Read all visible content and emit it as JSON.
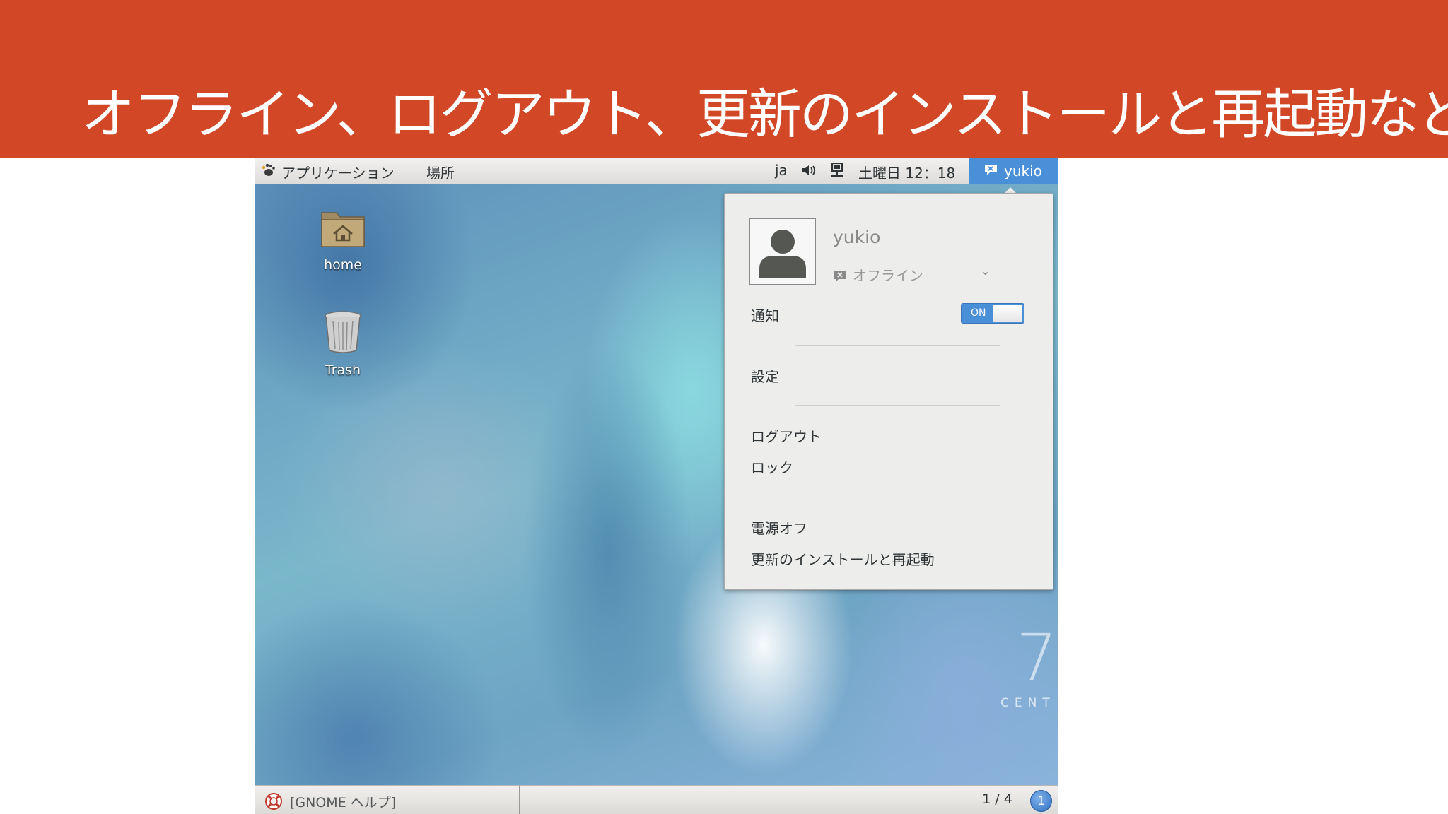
{
  "slide": {
    "title": "オフライン、ログアウト、更新のインストールと再起動など",
    "banner_color": "#d24726"
  },
  "topbar": {
    "applications_label": "アプリケーション",
    "places_label": "場所",
    "input_method": "ja",
    "datetime": "土曜日 12：18",
    "user_button": "yukio",
    "icons": [
      "gnome-foot-icon",
      "volume-icon",
      "network-icon",
      "chat-status-icon"
    ]
  },
  "desktop_icons": [
    {
      "label": "home",
      "icon": "home-folder-icon"
    },
    {
      "label": "Trash",
      "icon": "trash-icon"
    }
  ],
  "user_menu": {
    "username": "yukio",
    "status": "オフライン",
    "notifications_label": "通知",
    "notifications_toggle": "ON",
    "settings": "設定",
    "logout": "ログアウト",
    "lock": "ロック",
    "power_off": "電源オフ",
    "install_updates_restart": "更新のインストールと再起動"
  },
  "watermark": {
    "number": "7",
    "text": "CENT"
  },
  "bottombar": {
    "task_label": "[GNOME ヘルプ]",
    "workspace": "1 / 4",
    "notification_count": "1"
  },
  "colors": {
    "accent": "#4a90d9",
    "menu_bg": "#ededec"
  }
}
